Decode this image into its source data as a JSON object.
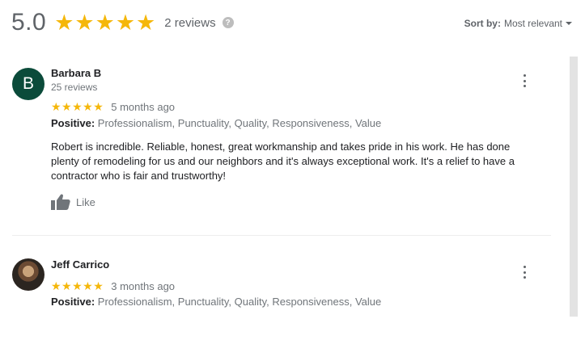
{
  "summary": {
    "score": "5.0",
    "stars": "★★★★★",
    "count_text": "2 reviews",
    "help_icon": "?"
  },
  "sort": {
    "label": "Sort by:",
    "value": "Most relevant"
  },
  "reviews": [
    {
      "avatar_letter": "B",
      "author": "Barbara B",
      "author_sub": "25 reviews",
      "stars": "★★★★★",
      "time": "5 months ago",
      "positive_label": "Positive:",
      "positive_text": " Professionalism, Punctuality, Quality, Responsiveness, Value",
      "text": "Robert is incredible. Reliable, honest, great workmanship and takes pride in his work. He has done plenty of remodeling for us and our neighbors and it's always exceptional work. It's a relief to have a contractor who is fair and trustworthy!",
      "like_label": "Like"
    },
    {
      "author": "Jeff Carrico",
      "stars": "★★★★★",
      "time": "3 months ago",
      "positive_label": "Positive:",
      "positive_text": " Professionalism, Punctuality, Quality, Responsiveness, Value"
    }
  ],
  "colors": {
    "star": "#f5b70a",
    "avatar_b": "#0b4b3a"
  }
}
